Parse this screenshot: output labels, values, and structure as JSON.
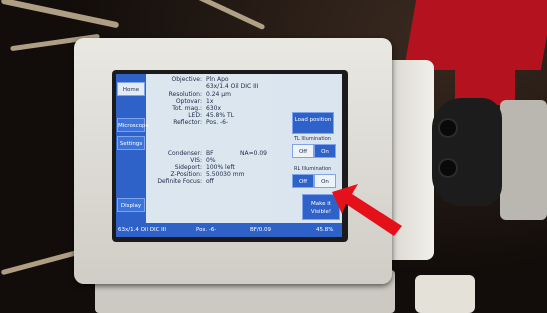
{
  "sidebar": {
    "items": [
      {
        "label": "Home"
      },
      {
        "label": "Microscope"
      },
      {
        "label": "Settings"
      },
      {
        "label": "Display"
      }
    ]
  },
  "info": {
    "objective": {
      "label": "Objective:",
      "value": "Pln Apo"
    },
    "objective_detail": "63x/1.4 Oil DIC III",
    "resolution": {
      "label": "Resolution:",
      "value": "0.24 µm"
    },
    "optovar": {
      "label": "Optovar:",
      "value": "1x"
    },
    "tot_mag": {
      "label": "Tot. mag.:",
      "value": "630x"
    },
    "led": {
      "label": "LED:",
      "value": "45.8%  TL"
    },
    "reflector": {
      "label": "Reflector:",
      "value": "Pos. -6-"
    },
    "condenser": {
      "label": "Condenser:",
      "value": "BF"
    },
    "na": "NA=0.09",
    "vis": {
      "label": "VIS:",
      "value": "0%"
    },
    "sideport": {
      "label": "Sideport:",
      "value": "100%  left"
    },
    "z_position": {
      "label": "Z-Position:",
      "value": "5.50030 mm"
    },
    "definite_focus": {
      "label": "Definite Focus:",
      "value": "off"
    }
  },
  "right_panel": {
    "load_position": "Load position",
    "tl_illumination": "TL Illumination",
    "tl_off": "Off",
    "tl_on": "On",
    "rl_illumination": "RL Illumination",
    "rl_off": "Off",
    "rl_on": "On",
    "make_visible": "Make it Visible!"
  },
  "status_bar": {
    "objective": "63x/1.4 Oil DIC III",
    "position": "Pos. -6-",
    "bf": "BF/0.09",
    "percent": "45.8%"
  },
  "colors": {
    "screen_blue": "#2f62c9",
    "screen_bg": "#dce6ee",
    "arrow_red": "#e4111b"
  }
}
